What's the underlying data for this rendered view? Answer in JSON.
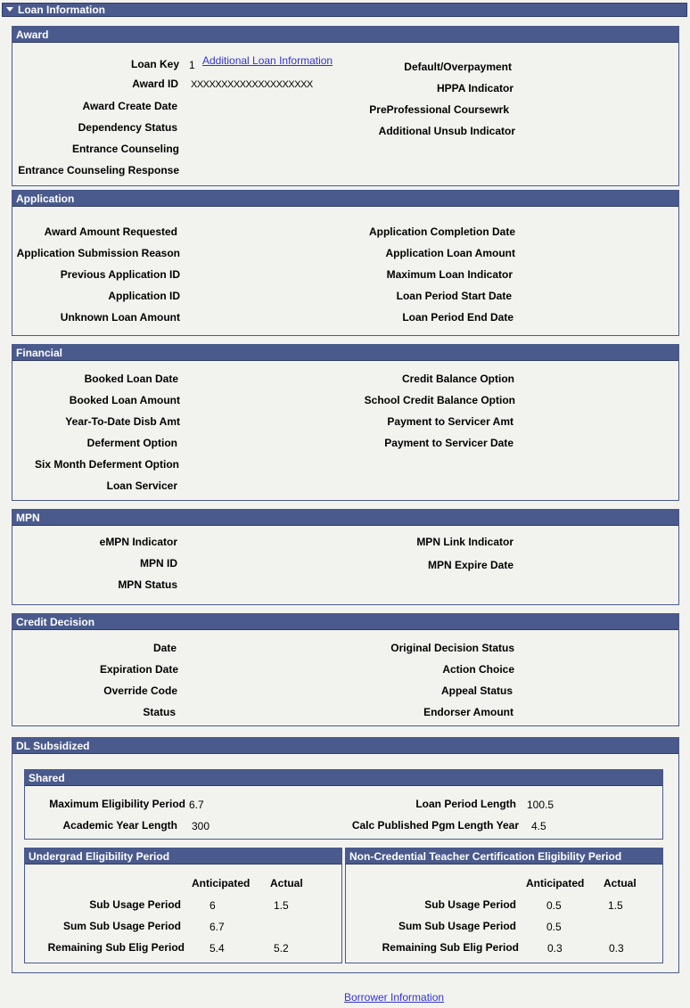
{
  "title": "Loan Information",
  "award": {
    "header": "Award",
    "loan_key_label": "Loan Key",
    "loan_key_value": "1",
    "additional_loan_link": "Additional Loan Information",
    "award_id_label": "Award ID",
    "award_id_value": "XXXXXXXXXXXXXXXXXXXX",
    "award_create_date_label": "Award Create Date",
    "dependency_status_label": "Dependency Status",
    "entrance_counseling_label": "Entrance Counseling",
    "entrance_counseling_response_label": "Entrance Counseling Response",
    "default_overpayment_label": "Default/Overpayment",
    "hppa_indicator_label": "HPPA Indicator",
    "preprofessional_label": "PreProfessional Coursewrk",
    "additional_unsub_label": "Additional Unsub Indicator"
  },
  "application": {
    "header": "Application",
    "left": [
      "Award Amount Requested",
      "Application Submission Reason",
      "Previous Application ID",
      "Application ID",
      "Unknown Loan Amount"
    ],
    "right": [
      "Application Completion Date",
      "Application Loan Amount",
      "Maximum Loan Indicator",
      "Loan Period Start Date",
      "Loan Period End Date"
    ]
  },
  "financial": {
    "header": "Financial",
    "left": [
      "Booked Loan Date",
      "Booked Loan Amount",
      "Year-To-Date Disb Amt",
      "Deferment Option",
      "Six Month Deferment Option",
      "Loan Servicer"
    ],
    "right": [
      "Credit Balance Option",
      "School Credit Balance Option",
      "Payment to Servicer Amt",
      "Payment to Servicer Date"
    ]
  },
  "mpn": {
    "header": "MPN",
    "left": [
      "eMPN Indicator",
      "MPN ID",
      "MPN Status"
    ],
    "right": [
      "MPN Link Indicator",
      "MPN Expire Date"
    ]
  },
  "credit_decision": {
    "header": "Credit Decision",
    "left": [
      "Date",
      "Expiration Date",
      "Override Code",
      "Status"
    ],
    "right": [
      "Original Decision Status",
      "Action Choice",
      "Appeal Status",
      "Endorser Amount"
    ]
  },
  "dl_subsidized": {
    "header": "DL Subsidized",
    "shared": {
      "header": "Shared",
      "max_elig_label": "Maximum Eligibility Period",
      "max_elig_value": "6.7",
      "acad_year_label": "Academic Year Length",
      "acad_year_value": "300",
      "loan_period_label": "Loan Period Length",
      "loan_period_value": "100.5",
      "calc_pgm_label": "Calc Published Pgm Length Year",
      "calc_pgm_value": "4.5"
    },
    "undergrad": {
      "header": "Undergrad Eligibility Period",
      "col_anticipated": "Anticipated",
      "col_actual": "Actual",
      "rows": [
        {
          "label": "Sub Usage Period",
          "anticipated": "6",
          "actual": "1.5"
        },
        {
          "label": "Sum Sub Usage Period",
          "anticipated": "6.7",
          "actual": ""
        },
        {
          "label": "Remaining Sub Elig Period",
          "anticipated": "5.4",
          "actual": "5.2"
        }
      ]
    },
    "noncredential": {
      "header": "Non-Credential Teacher Certification Eligibility Period",
      "col_anticipated": "Anticipated",
      "col_actual": "Actual",
      "rows": [
        {
          "label": "Sub Usage Period",
          "anticipated": "0.5",
          "actual": "1.5"
        },
        {
          "label": "Sum Sub Usage Period",
          "anticipated": "0.5",
          "actual": ""
        },
        {
          "label": "Remaining Sub Elig Period",
          "anticipated": "0.3",
          "actual": "0.3"
        }
      ]
    }
  },
  "footer": {
    "borrower_link": "Borrower Information"
  }
}
